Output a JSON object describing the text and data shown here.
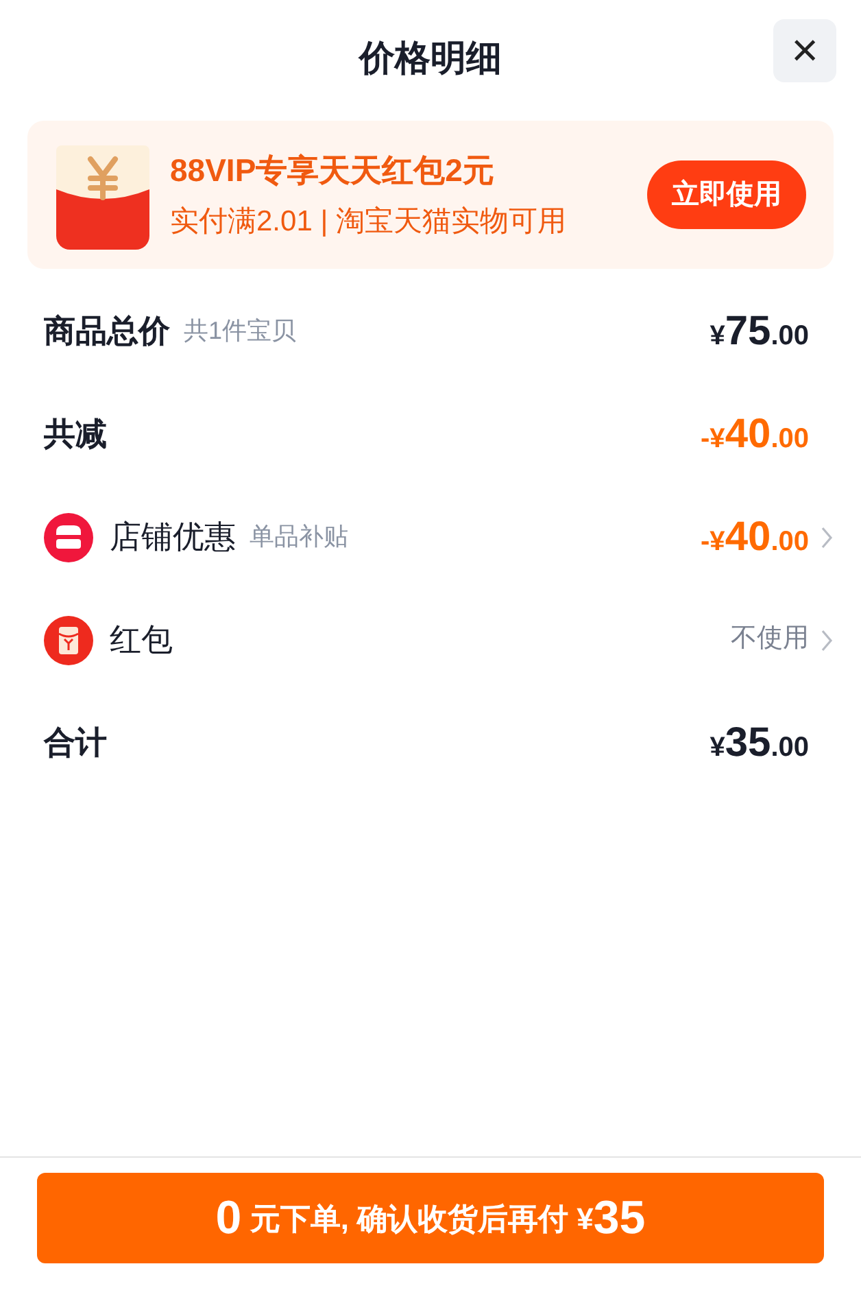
{
  "header": {
    "title": "价格明细",
    "close_label": "×"
  },
  "promo": {
    "title": "88VIP专享天天红包2元",
    "subtitle": "实付满2.01 | 淘宝天猫实物可用",
    "button": "立即使用"
  },
  "rows": [
    {
      "kind": "plain",
      "label": "商品总价",
      "note": "共1件宝贝",
      "amount": {
        "currency": "¥",
        "integer": "75",
        "cents": ".00"
      },
      "color": "#1a1e2b",
      "chevron": false
    },
    {
      "kind": "plain",
      "label": "共减",
      "amount": {
        "sign": "-",
        "currency": "¥",
        "integer": "40",
        "cents": ".00"
      },
      "color": "#ff6a00",
      "chevron": false
    },
    {
      "kind": "store",
      "label": "店铺优惠",
      "note": "单品补贴",
      "amount": {
        "sign": "-",
        "currency": "¥",
        "integer": "40",
        "cents": ".00"
      },
      "color": "#ff6a00",
      "chevron": true
    },
    {
      "kind": "red-packet",
      "label": "红包",
      "value": "不使用",
      "chevron": true
    },
    {
      "kind": "plain",
      "label": "合计",
      "amount": {
        "currency": "¥",
        "integer": "35",
        "cents": ".00"
      },
      "color": "#1a1e2b",
      "chevron": false
    }
  ],
  "pay_button": {
    "parts": [
      {
        "text": "0",
        "big": true
      },
      {
        "text": " 元下单, 确认收货后再付 ¥",
        "big": false
      },
      {
        "text": "35",
        "big": true
      }
    ]
  }
}
